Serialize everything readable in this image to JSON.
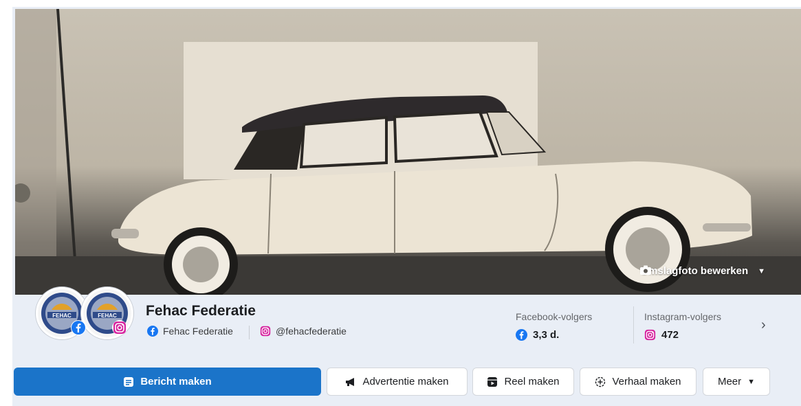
{
  "cover": {
    "edit_label": "Omslagfoto bewerken",
    "icon": "camera-icon"
  },
  "profile": {
    "name": "Fehac Federatie",
    "facebook_account": "Fehac Federatie",
    "instagram_account": "@fehacfederatie",
    "avatar_text": "FEHAC"
  },
  "stats": {
    "facebook_label": "Facebook-volgers",
    "facebook_value": "3,3 d.",
    "instagram_label": "Instagram-volgers",
    "instagram_value": "472"
  },
  "actions": {
    "create_post": "Bericht maken",
    "create_ad": "Advertentie maken",
    "create_reel": "Reel maken",
    "create_story": "Verhaal maken",
    "more": "Meer"
  },
  "colors": {
    "facebook_blue": "#1877f2",
    "primary_button": "#1b74c9",
    "instagram_pink": "#d6249f"
  }
}
